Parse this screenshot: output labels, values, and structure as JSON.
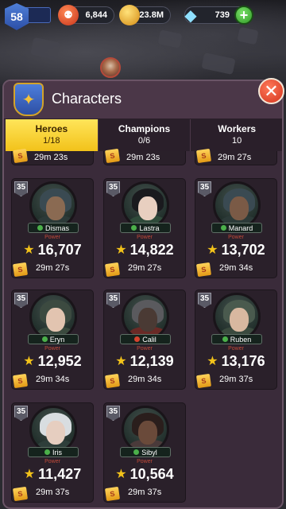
{
  "resources": {
    "level": "58",
    "food": "6,844",
    "gold": "23.8M",
    "gems": "739",
    "food_icon": "food-icon",
    "gold_icon": "coin-icon",
    "gems_icon": "diamond-icon"
  },
  "panel": {
    "title": "Characters",
    "close_icon": "close-icon"
  },
  "tabs": [
    {
      "label": "Heroes",
      "count": "1/18",
      "active": true
    },
    {
      "label": "Champions",
      "count": "0/6",
      "active": false
    },
    {
      "label": "Workers",
      "count": "10",
      "active": false
    }
  ],
  "partial_row": [
    "29m 23s",
    "29m 23s",
    "29m 27s"
  ],
  "power_label": "Power",
  "heroes": [
    {
      "name": "Dismas",
      "level": "35",
      "power": "16,707",
      "timer": "29m 27s",
      "class_color": "#4bb04a",
      "hair": "#3a4a52",
      "face": "#8a6a52",
      "body": "#2c3a38"
    },
    {
      "name": "Lastra",
      "level": "35",
      "power": "14,822",
      "timer": "29m 27s",
      "class_color": "#4bb04a",
      "hair": "#1a1a1e",
      "face": "#e8cfc0",
      "body": "#2f4a3a"
    },
    {
      "name": "Manard",
      "level": "35",
      "power": "13,702",
      "timer": "29m 34s",
      "class_color": "#4bb04a",
      "hair": "#3a4a52",
      "face": "#7a5a46",
      "body": "#2c3a38"
    },
    {
      "name": "Eryn",
      "level": "35",
      "power": "12,952",
      "timer": "29m 34s",
      "class_color": "#4bb04a",
      "hair": "#3c4a40",
      "face": "#e2c4b0",
      "body": "#3a4a3e"
    },
    {
      "name": "Calil",
      "level": "35",
      "power": "12,139",
      "timer": "29m 34s",
      "class_color": "#d6432e",
      "hair": "#5a5a5e",
      "face": "#4a3a34",
      "body": "#6a2a26"
    },
    {
      "name": "Ruben",
      "level": "35",
      "power": "13,176",
      "timer": "29m 37s",
      "class_color": "#4bb04a",
      "hair": "#4a5a4e",
      "face": "#d8b8a0",
      "body": "#3a4a3e"
    },
    {
      "name": "Iris",
      "level": "35",
      "power": "11,427",
      "timer": "29m 37s",
      "class_color": "#4bb04a",
      "hair": "#d8dde0",
      "face": "#e6cec0",
      "body": "#2e3e3a"
    },
    {
      "name": "Sibyl",
      "level": "35",
      "power": "10,564",
      "timer": "29m 37s",
      "class_color": "#4bb04a",
      "hair": "#2a1e1c",
      "face": "#6a4a3a",
      "body": "#4a3a3a"
    }
  ]
}
